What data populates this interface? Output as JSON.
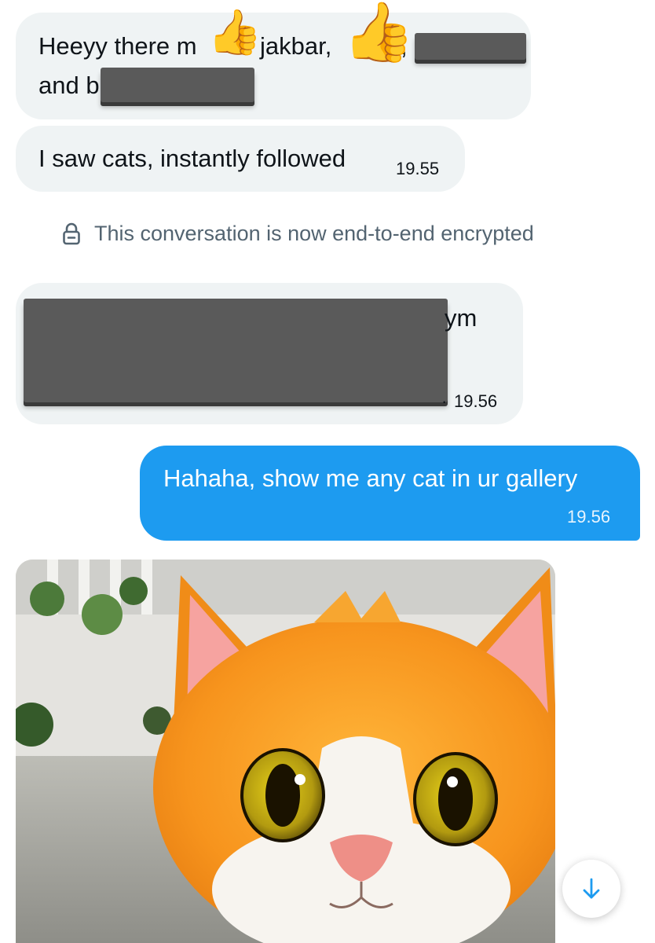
{
  "messages": {
    "m1": {
      "line1_a": "Heeyy there m",
      "line1_b": "jakbar,",
      "line1_c": ", g",
      "line2": "and b"
    },
    "m2": {
      "text": "I saw cats, instantly followed",
      "time": "19.55"
    },
    "system": {
      "text": "This conversation is now end-to-end encrypted",
      "icon": "lock-icon"
    },
    "m3": {
      "visible_text": "ym",
      "time": "19.56",
      "time_prefix": "·"
    },
    "m4": {
      "text": "Hahaha, show me any cat in ur gallery",
      "time": "19.56"
    }
  },
  "colors": {
    "incoming_bubble": "#eff3f4",
    "outgoing_bubble": "#1d9bf0",
    "system_text": "#536471",
    "redaction": "#5a5a5a",
    "scroll_arrow": "#1d9bf0"
  },
  "icons": {
    "thumbs_up": "👍",
    "scroll_down": "arrow-down-icon"
  },
  "media": {
    "description_icon": "cat-memoji-photo"
  }
}
